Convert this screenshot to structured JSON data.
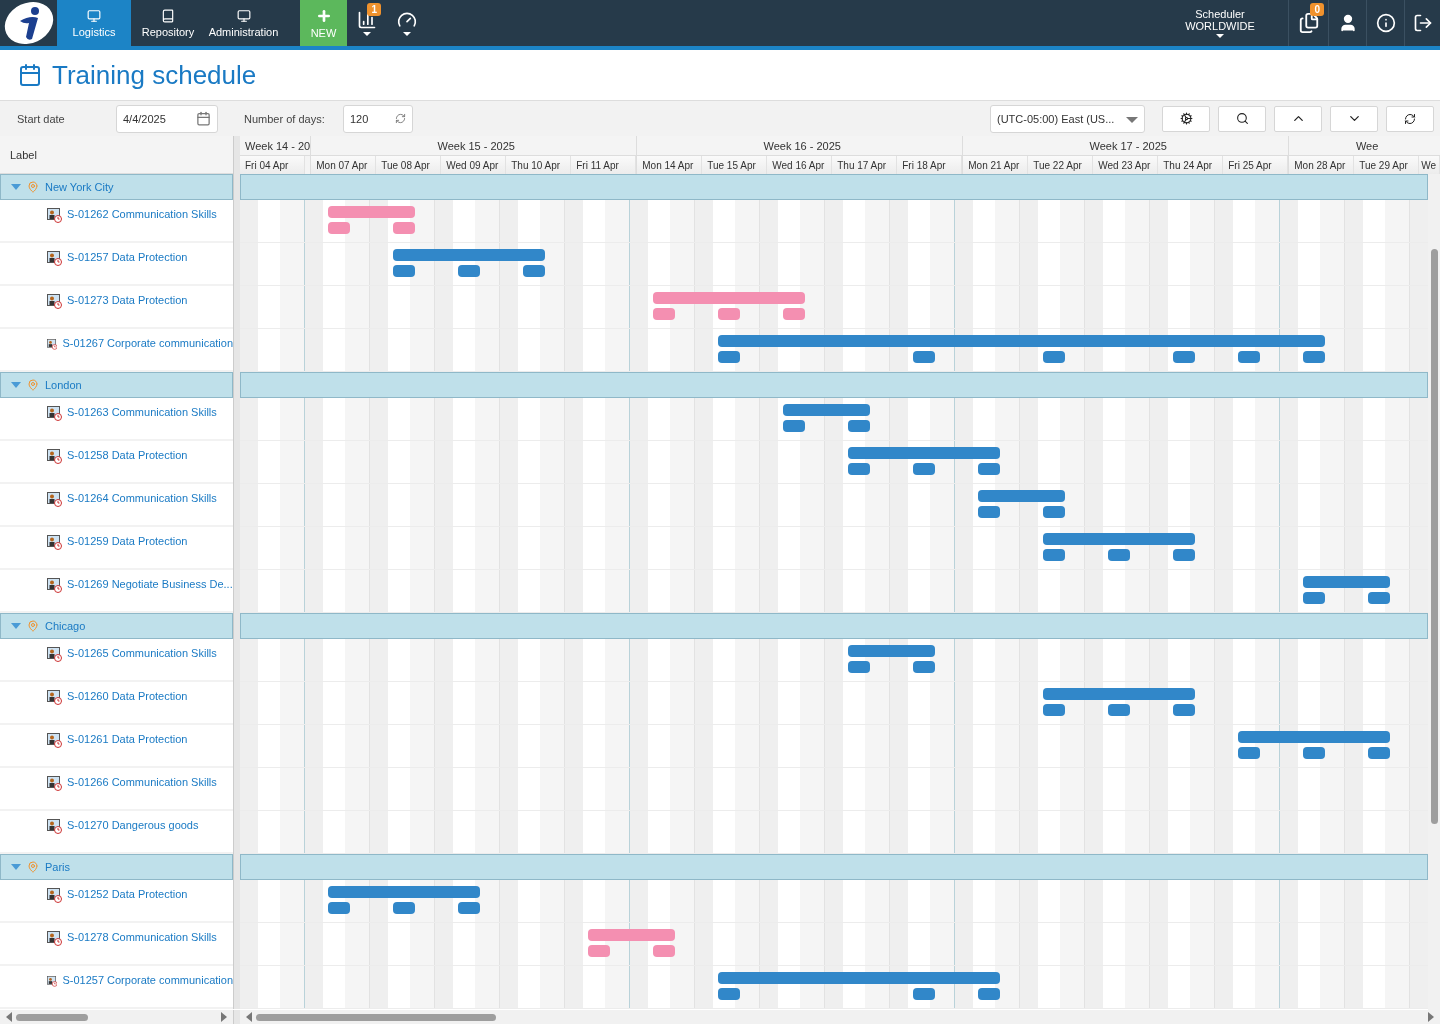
{
  "nav": {
    "tabs": [
      {
        "label": "Logistics",
        "selected": true
      },
      {
        "label": "Repository",
        "selected": false
      },
      {
        "label": "Administration",
        "selected": false
      }
    ],
    "new_button": "NEW",
    "reports_badge": "1",
    "account": {
      "line1": "Scheduler",
      "line2": "WORLDWIDE"
    },
    "documents_badge": "0"
  },
  "title": "Training schedule",
  "filters": {
    "start_date": {
      "label": "Start date",
      "value": "4/4/2025"
    },
    "days": {
      "label": "Number of days:",
      "value": "120"
    },
    "timezone": "(UTC-05:00) East (US..."
  },
  "gantt": {
    "label_header": "Label",
    "weeks": [
      {
        "label": "Week 14 - 20",
        "days": [
          "Fri 04 Apr"
        ]
      },
      {
        "label": "Week 15 - 2025",
        "days": [
          "Mon 07 Apr",
          "Tue 08 Apr",
          "Wed 09 Apr",
          "Thu 10 Apr",
          "Fri 11 Apr"
        ]
      },
      {
        "label": "Week 16 - 2025",
        "days": [
          "Mon 14 Apr",
          "Tue 15 Apr",
          "Wed 16 Apr",
          "Thu 17 Apr",
          "Fri 18 Apr"
        ]
      },
      {
        "label": "Week 17 - 2025",
        "days": [
          "Mon 21 Apr",
          "Tue 22 Apr",
          "Wed 23 Apr",
          "Thu 24 Apr",
          "Fri 25 Apr"
        ]
      },
      {
        "label": "Wee",
        "days": [
          "Mon 28 Apr",
          "Tue 29 Apr",
          "We"
        ]
      }
    ],
    "groups": [
      {
        "name": "New York City",
        "expanded": true,
        "tasks": [
          {
            "label": "S-01262 Communication Skills",
            "color": "#f48fb1",
            "sessions": [
              false,
              true,
              true,
              false,
              false,
              false,
              false,
              false,
              false,
              false,
              false,
              false,
              false,
              false,
              false,
              false,
              false,
              false,
              false
            ]
          },
          {
            "label": "S-01257 Data Protection",
            "color": "#3187c9",
            "sessions": [
              false,
              false,
              true,
              true,
              true,
              false,
              false,
              false,
              false,
              false,
              false,
              false,
              false,
              false,
              false,
              false,
              false,
              false,
              false
            ]
          },
          {
            "label": "S-01273 Data Protection",
            "color": "#f48fb1",
            "sessions": [
              false,
              false,
              false,
              false,
              false,
              false,
              true,
              true,
              true,
              false,
              false,
              false,
              false,
              false,
              false,
              false,
              false,
              false,
              false
            ]
          },
          {
            "label": "S-01267 Corporate communication",
            "color": "#3187c9",
            "sessions": [
              false,
              false,
              false,
              false,
              false,
              false,
              false,
              true,
              false,
              false,
              true,
              false,
              true,
              false,
              true,
              true,
              true,
              false,
              false
            ]
          }
        ]
      },
      {
        "name": "London",
        "expanded": true,
        "tasks": [
          {
            "label": "S-01263 Communication Skills",
            "color": "#3187c9",
            "sessions": [
              false,
              false,
              false,
              false,
              false,
              false,
              false,
              false,
              true,
              true,
              false,
              false,
              false,
              false,
              false,
              false,
              false,
              false,
              false
            ]
          },
          {
            "label": "S-01258 Data Protection",
            "color": "#3187c9",
            "sessions": [
              false,
              false,
              false,
              false,
              false,
              false,
              false,
              false,
              false,
              true,
              true,
              true,
              false,
              false,
              false,
              false,
              false,
              false,
              false
            ]
          },
          {
            "label": "S-01264 Communication Skills",
            "color": "#3187c9",
            "sessions": [
              false,
              false,
              false,
              false,
              false,
              false,
              false,
              false,
              false,
              false,
              false,
              true,
              true,
              false,
              false,
              false,
              false,
              false,
              false
            ]
          },
          {
            "label": "S-01259 Data Protection",
            "color": "#3187c9",
            "sessions": [
              false,
              false,
              false,
              false,
              false,
              false,
              false,
              false,
              false,
              false,
              false,
              false,
              true,
              true,
              true,
              false,
              false,
              false,
              false
            ]
          },
          {
            "label": "S-01269 Negotiate Business De...",
            "color": "#3187c9",
            "sessions": [
              false,
              false,
              false,
              false,
              false,
              false,
              false,
              false,
              false,
              false,
              false,
              false,
              false,
              false,
              false,
              false,
              true,
              true,
              false
            ]
          }
        ]
      },
      {
        "name": "Chicago",
        "expanded": true,
        "tasks": [
          {
            "label": "S-01265 Communication Skills",
            "color": "#3187c9",
            "sessions": [
              false,
              false,
              false,
              false,
              false,
              false,
              false,
              false,
              false,
              true,
              true,
              false,
              false,
              false,
              false,
              false,
              false,
              false,
              false
            ]
          },
          {
            "label": "S-01260 Data Protection",
            "color": "#3187c9",
            "sessions": [
              false,
              false,
              false,
              false,
              false,
              false,
              false,
              false,
              false,
              false,
              false,
              false,
              true,
              true,
              true,
              false,
              false,
              false,
              false
            ]
          },
          {
            "label": "S-01261 Data Protection",
            "color": "#3187c9",
            "sessions": [
              false,
              false,
              false,
              false,
              false,
              false,
              false,
              false,
              false,
              false,
              false,
              false,
              false,
              false,
              false,
              true,
              true,
              true,
              false
            ]
          },
          {
            "label": "S-01266 Communication Skills",
            "sessions": [
              false,
              false,
              false,
              false,
              false,
              false,
              false,
              false,
              false,
              false,
              false,
              false,
              false,
              false,
              false,
              false,
              false,
              false,
              false
            ]
          },
          {
            "label": "S-01270 Dangerous goods",
            "sessions": [
              false,
              false,
              false,
              false,
              false,
              false,
              false,
              false,
              false,
              false,
              false,
              false,
              false,
              false,
              false,
              false,
              false,
              false,
              false
            ]
          }
        ]
      },
      {
        "name": "Paris",
        "expanded": true,
        "tasks": [
          {
            "label": "S-01252 Data Protection",
            "color": "#3187c9",
            "sessions": [
              false,
              true,
              true,
              true,
              false,
              false,
              false,
              false,
              false,
              false,
              false,
              false,
              false,
              false,
              false,
              false,
              false,
              false,
              false
            ]
          },
          {
            "label": "S-01278 Communication Skills",
            "color": "#f48fb1",
            "sessions": [
              false,
              false,
              false,
              false,
              false,
              true,
              true,
              false,
              false,
              false,
              false,
              false,
              false,
              false,
              false,
              false,
              false,
              false,
              false
            ]
          },
          {
            "label": "S-01257 Corporate communication",
            "color": "#3187c9",
            "sessions": [
              false,
              false,
              false,
              false,
              false,
              false,
              false,
              true,
              false,
              false,
              true,
              true,
              false,
              false,
              false,
              false,
              false,
              false,
              false
            ]
          }
        ]
      }
    ]
  }
}
